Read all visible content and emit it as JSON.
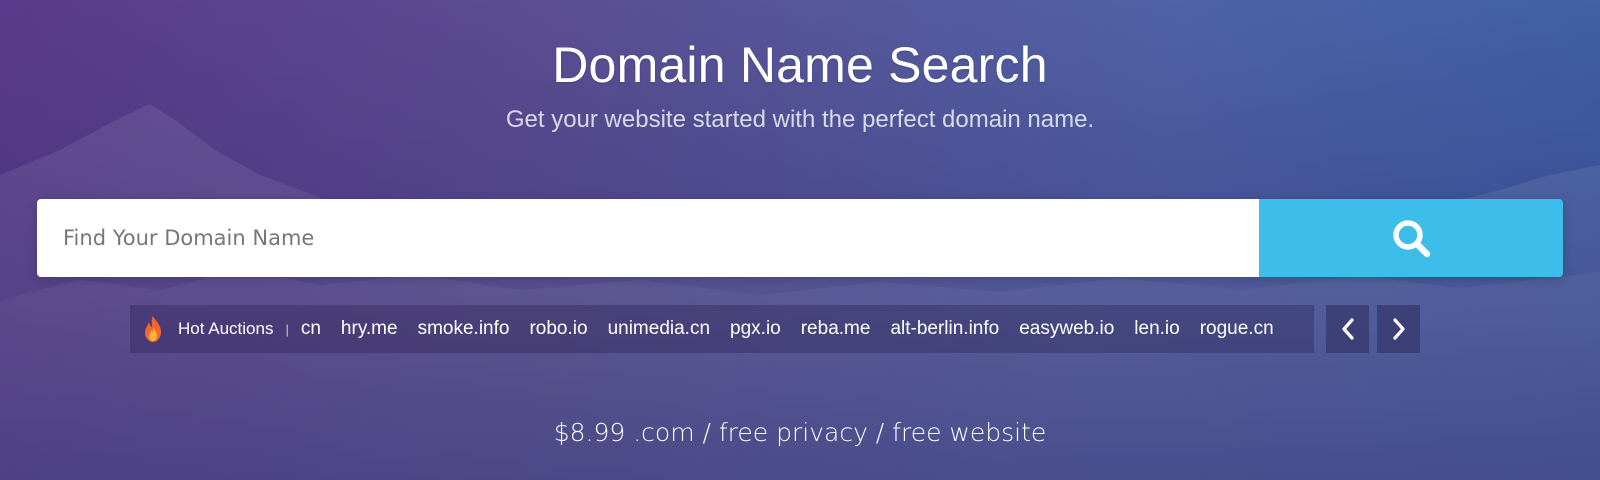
{
  "hero": {
    "title": "Domain Name Search",
    "subtitle": "Get your website started with the perfect domain name."
  },
  "search": {
    "placeholder": "Find Your Domain Name",
    "value": "",
    "button_icon": "search-icon"
  },
  "auctions": {
    "icon": "flame-icon",
    "label": "Hot Auctions",
    "separator": "|",
    "domains": [
      "cn",
      "hry.me",
      "smoke.info",
      "robo.io",
      "unimedia.cn",
      "pgx.io",
      "reba.me",
      "alt-berlin.info",
      "easyweb.io",
      "len.io",
      "rogue.cn"
    ],
    "prev_icon": "chevron-left-icon",
    "next_icon": "chevron-right-icon"
  },
  "promo": {
    "text": "$8.99 .com / free privacy / free website"
  },
  "colors": {
    "search_button": "#3dbde9",
    "text": "#ffffff",
    "gradient_start": "#5a3a8a",
    "gradient_end": "#3e5fa6"
  }
}
